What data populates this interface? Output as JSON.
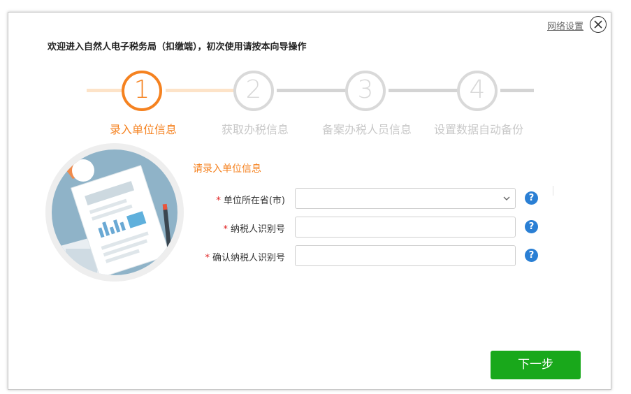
{
  "header": {
    "network_settings": "网络设置",
    "welcome_text": "欢迎进入自然人电子税务局（扣缴端），初次使用请按本向导操作"
  },
  "steps": [
    {
      "number": "1",
      "label": "录入单位信息",
      "active": true
    },
    {
      "number": "2",
      "label": "获取办税信息",
      "active": false
    },
    {
      "number": "3",
      "label": "备案办税人员信息",
      "active": false
    },
    {
      "number": "4",
      "label": "设置数据自动备份",
      "active": false
    }
  ],
  "form": {
    "title": "请录入单位信息",
    "required_mark": "*",
    "province_label": "单位所在省(市)",
    "province_value": "",
    "taxpayer_id_label": "纳税人识别号",
    "taxpayer_id_value": "",
    "confirm_id_label": "确认纳税人识别号",
    "confirm_id_value": "",
    "help_glyph": "?"
  },
  "footer": {
    "next_label": "下一步"
  },
  "colors": {
    "accent": "#f58220",
    "inactive": "#d9d9d9",
    "primary_button": "#19a81b",
    "help_icon": "#2a7fd4"
  }
}
